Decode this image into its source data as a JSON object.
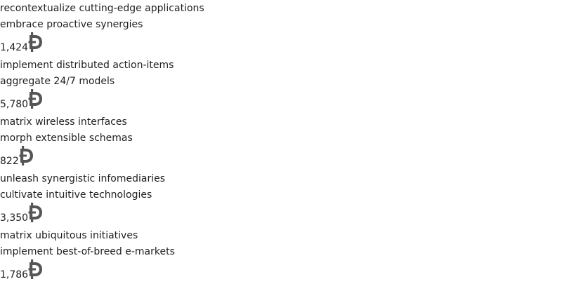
{
  "items": [
    {
      "title": "recontextualize cutting-edge applications",
      "subtitle": "embrace proactive synergies",
      "amount": "1,424",
      "currency_icon": "dogecoin-icon"
    },
    {
      "title": "implement distributed action-items",
      "subtitle": "aggregate 24/7 models",
      "amount": "5,780",
      "currency_icon": "dogecoin-icon"
    },
    {
      "title": "matrix wireless interfaces",
      "subtitle": "morph extensible schemas",
      "amount": "822",
      "currency_icon": "dogecoin-icon"
    },
    {
      "title": "unleash synergistic infomediaries",
      "subtitle": "cultivate intuitive technologies",
      "amount": "3,350",
      "currency_icon": "dogecoin-icon"
    },
    {
      "title": "matrix ubiquitous initiatives",
      "subtitle": "implement best-of-breed e-markets",
      "amount": "1,786",
      "currency_icon": "dogecoin-icon"
    }
  ],
  "colors": {
    "text": "#1f1f1f",
    "icon": "#555555",
    "background": "#ffffff"
  }
}
